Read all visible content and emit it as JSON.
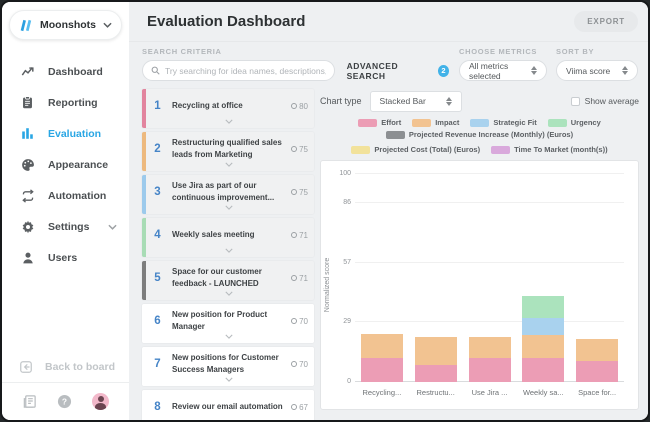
{
  "colors": {
    "accent_blue": "#29a6e4",
    "rank_blue": "#4584c7",
    "badge_blue": "#41b2e8"
  },
  "sidebar": {
    "workspace_name": "Moonshots &...",
    "items": [
      {
        "label": "Dashboard",
        "icon": "trend-chart-icon",
        "active": false,
        "chevron": false
      },
      {
        "label": "Reporting",
        "icon": "clipboard-icon",
        "active": false,
        "chevron": false
      },
      {
        "label": "Evaluation",
        "icon": "bar-chart-icon",
        "active": true,
        "chevron": false
      },
      {
        "label": "Appearance",
        "icon": "palette-icon",
        "active": false,
        "chevron": false
      },
      {
        "label": "Automation",
        "icon": "repeat-icon",
        "active": false,
        "chevron": false
      },
      {
        "label": "Settings",
        "icon": "gear-icon",
        "active": false,
        "chevron": true
      },
      {
        "label": "Users",
        "icon": "user-icon",
        "active": false,
        "chevron": false
      }
    ],
    "back_label": "Back to board"
  },
  "header": {
    "title": "Evaluation Dashboard",
    "export_label": "EXPORT"
  },
  "search": {
    "criteria_label": "SEARCH CRITERIA",
    "placeholder": "Try searching for idea names, descriptions, or creators...",
    "advanced_label": "ADVANCED SEARCH",
    "advanced_badge": "2",
    "choose_metrics_label": "CHOOSE METRICS",
    "metrics_value": "All metrics selected",
    "sort_by_label": "SORT BY",
    "sort_value": "Viima score"
  },
  "ideas": [
    {
      "rank": "1",
      "title": "Recycling at office",
      "score": "80",
      "accent": "#e2849e",
      "selected": true
    },
    {
      "rank": "2",
      "title": "Restructuring qualified sales leads from Marketing",
      "score": "75",
      "accent": "#edb97e",
      "selected": true
    },
    {
      "rank": "3",
      "title": "Use Jira as part of our continuous improvement...",
      "score": "75",
      "accent": "#9ccaec",
      "selected": true
    },
    {
      "rank": "4",
      "title": "Weekly sales meeting",
      "score": "71",
      "accent": "#a8dcb5",
      "selected": true
    },
    {
      "rank": "5",
      "title": "Space for our customer feedback - LAUNCHED",
      "score": "71",
      "accent": "#7d7d7d",
      "selected": true
    },
    {
      "rank": "6",
      "title": "New position for Product Manager",
      "score": "70",
      "accent": null,
      "selected": false
    },
    {
      "rank": "7",
      "title": "New positions for Customer Success Managers",
      "score": "70",
      "accent": null,
      "selected": false
    },
    {
      "rank": "8",
      "title": "Review our email automation",
      "score": "67",
      "accent": null,
      "selected": false
    }
  ],
  "chart_controls": {
    "type_label": "Chart type",
    "type_value": "Stacked Bar",
    "show_average_label": "Show average",
    "show_average_checked": false
  },
  "chart_data": {
    "type": "bar",
    "stacked": true,
    "title": "",
    "xlabel": "",
    "ylabel": "Normalized score",
    "ylim": [
      0,
      100
    ],
    "yticks": [
      0,
      29,
      57,
      86,
      100
    ],
    "grid": true,
    "legend_position": "top",
    "categories": [
      "Recycling...",
      "Restructu...",
      "Use Jira ...",
      "Weekly sa...",
      "Space for..."
    ],
    "series": [
      {
        "name": "Effort",
        "color": "#ec9db5",
        "values": [
          11.5,
          8.0,
          11.5,
          11.5,
          10.0
        ]
      },
      {
        "name": "Impact",
        "color": "#f2c391",
        "values": [
          11.5,
          13.5,
          10.0,
          11.0,
          10.5
        ]
      },
      {
        "name": "Strategic Fit",
        "color": "#a9d2ee",
        "values": [
          0,
          0,
          0,
          8.5,
          0
        ]
      },
      {
        "name": "Urgency",
        "color": "#abe3bd",
        "values": [
          0,
          0,
          0,
          10.5,
          0
        ]
      },
      {
        "name": "Projected Revenue Increase (Monthly) (Euros)",
        "color": "#8c8f92",
        "values": [
          0,
          0,
          0,
          0,
          0
        ]
      },
      {
        "name": "Projected Cost (Total) (Euros)",
        "color": "#f2e29b",
        "values": [
          0,
          0,
          0,
          0,
          0
        ]
      },
      {
        "name": "Time To Market (month(s))",
        "color": "#d9a9dc",
        "values": [
          0,
          0,
          0,
          0,
          0
        ]
      }
    ]
  }
}
